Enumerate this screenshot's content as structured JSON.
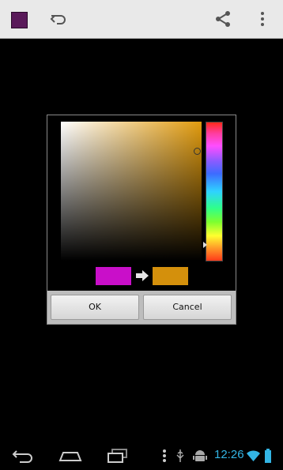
{
  "action_bar": {
    "current_color": "#5a1a5a",
    "icons": [
      "undo-icon",
      "share-icon",
      "overflow-menu-icon"
    ]
  },
  "color_picker": {
    "selected_hue_color": "#e19b0e",
    "old_color": "#c90fc9",
    "new_color": "#d4900c",
    "ok_label": "OK",
    "cancel_label": "Cancel"
  },
  "status_bar": {
    "time": "12:26",
    "accent": "#33b5e5"
  }
}
